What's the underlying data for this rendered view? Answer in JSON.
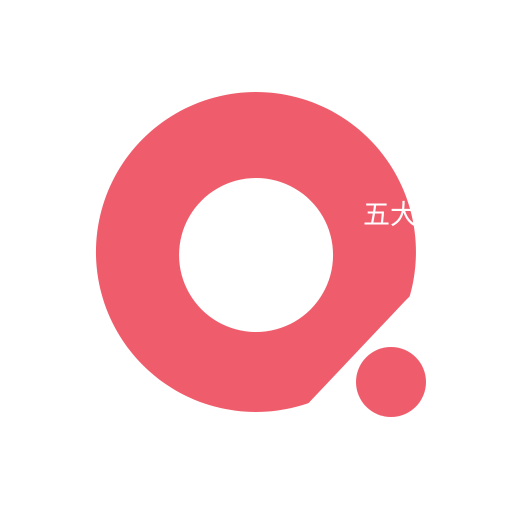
{
  "logo": {
    "text": "五大",
    "icon": "ring-with-dot-logo-icon",
    "colors": {
      "brand": "#ef5d6c",
      "background": "#ffffff",
      "text": "#ffffff"
    }
  }
}
